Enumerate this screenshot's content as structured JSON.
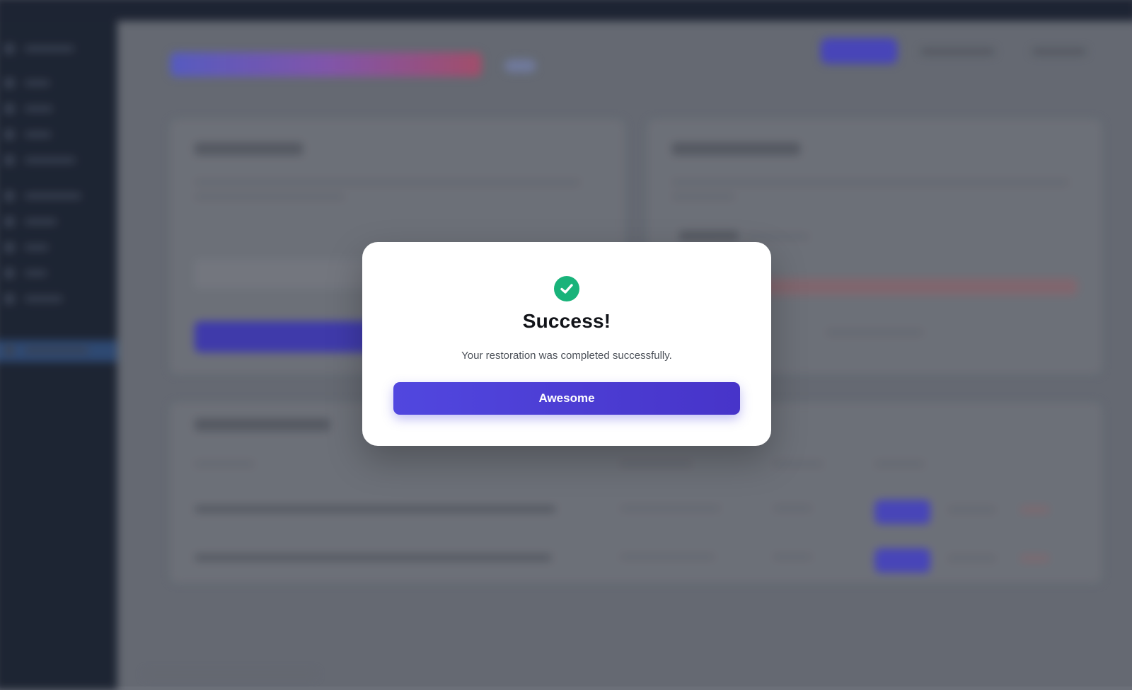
{
  "modal": {
    "icon": "check-circle-icon",
    "title": "Success!",
    "message": "Your restoration was completed successfully.",
    "button_label": "Awesome"
  },
  "colors": {
    "accent": "#4f46e5",
    "success": "#19b37a",
    "sidebar": "#1a2130",
    "backdrop": "#6b6f78"
  }
}
